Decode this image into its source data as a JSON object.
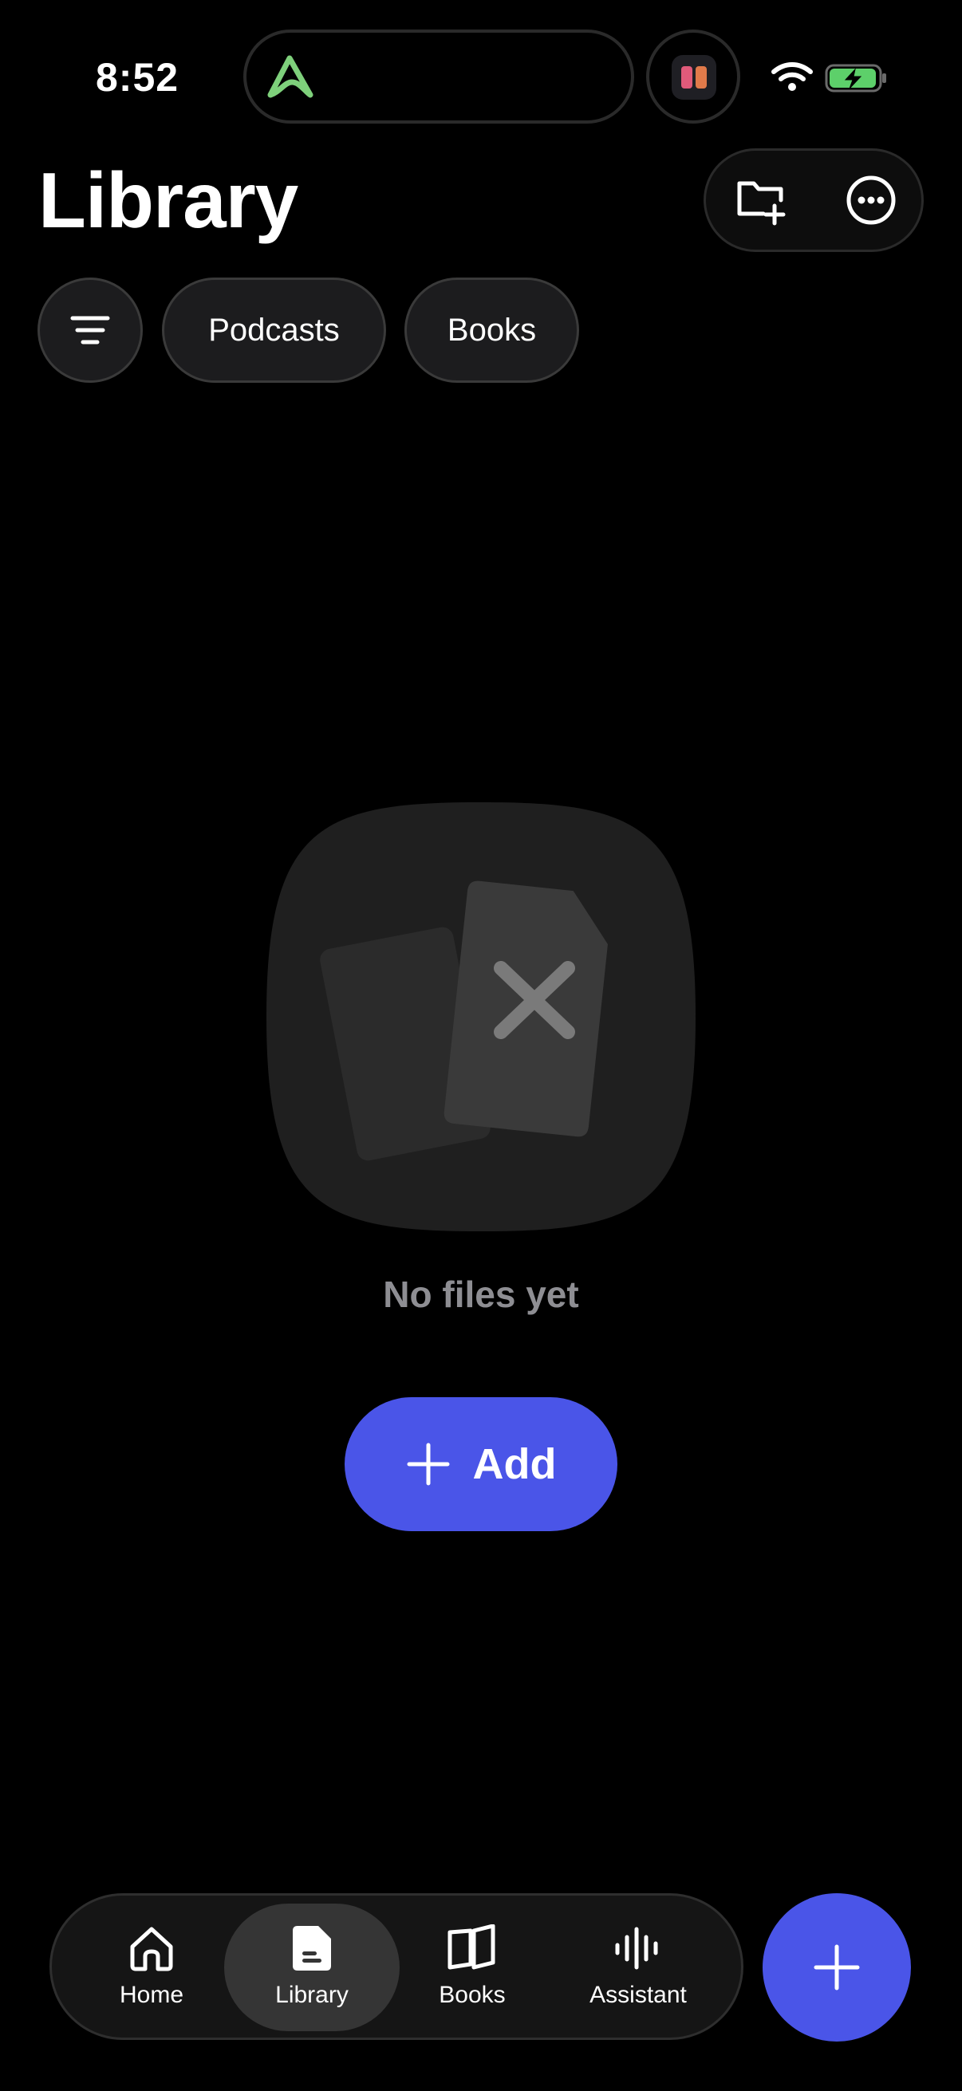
{
  "status_bar": {
    "time": "8:52"
  },
  "header": {
    "title": "Library",
    "new_folder_icon": "folder-plus-icon",
    "more_icon": "ellipsis-circle-icon"
  },
  "filters": {
    "filter_icon": "filter-lines-icon",
    "chips": [
      "Podcasts",
      "Books"
    ]
  },
  "empty_state": {
    "message": "No files yet",
    "add_label": "Add"
  },
  "tab_bar": {
    "active": "Library",
    "tabs": [
      {
        "label": "Home",
        "icon": "house-icon"
      },
      {
        "label": "Library",
        "icon": "document-icon"
      },
      {
        "label": "Books",
        "icon": "open-book-icon"
      },
      {
        "label": "Assistant",
        "icon": "waveform-icon"
      }
    ]
  },
  "colors": {
    "accent": "#4a55e8",
    "background": "#000000",
    "chip_bg": "#1c1c1e",
    "muted_text": "#8e8e93"
  }
}
